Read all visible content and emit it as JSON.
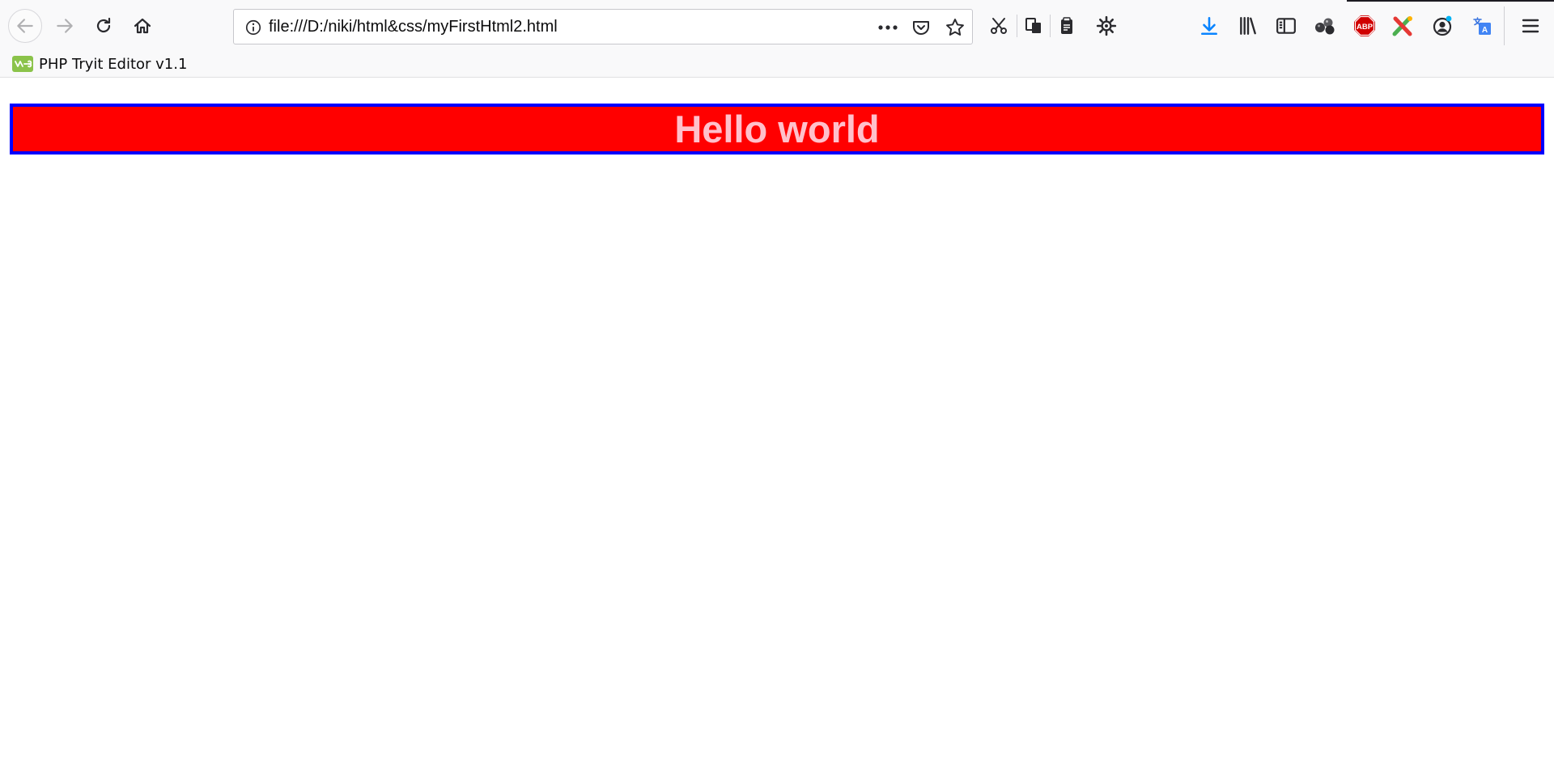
{
  "browser": {
    "url": "file:///D:/niki/html&css/myFirstHtml2.html",
    "bookmarks": [
      {
        "label": "PHP Tryit Editor v1.1",
        "icon": "php-tryit-icon"
      }
    ]
  },
  "toolbar_icons": [
    "back-arrow-icon",
    "forward-arrow-icon",
    "reload-icon",
    "home-icon",
    "info-icon",
    "page-actions-icon",
    "pocket-icon",
    "bookmark-star-icon",
    "cut-icon",
    "copy-icon",
    "paste-icon",
    "customize-gear-icon",
    "downloads-icon",
    "library-icon",
    "sidebar-icon",
    "extension-balls-icon",
    "adblock-plus-icon",
    "tools-extension-icon",
    "account-icon",
    "translate-icon",
    "menu-icon"
  ],
  "adblock_label": "ABP",
  "page": {
    "heading": "Hello world"
  },
  "colors": {
    "heading_bg": "#ff0000",
    "heading_border": "#0000ff",
    "heading_text": "#ffc0cb",
    "downloads_accent": "#0a84ff",
    "adblock_red": "#d00000"
  }
}
